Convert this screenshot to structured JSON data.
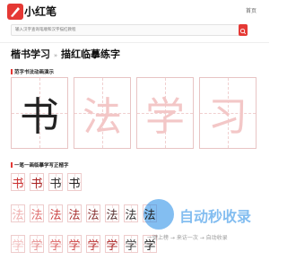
{
  "header": {
    "logo_text": "小红笔",
    "home_link": "首页",
    "search_placeholder": "输入汉字查询笔顺和汉字描红教程"
  },
  "page": {
    "title": "楷书学习",
    "title_sep": "»",
    "title_sub": "描红临摹练字"
  },
  "sections": {
    "demo_title": "范字书法动画演示",
    "practice_title": "一笔一画临摹学写正楷字"
  },
  "big_chars": [
    "书",
    "法",
    "学",
    "习"
  ],
  "rows": [
    [
      "书",
      "书",
      "书",
      "书"
    ],
    [
      "法",
      "法",
      "法",
      "法",
      "法",
      "法",
      "法",
      "法"
    ],
    [
      "学",
      "学",
      "学",
      "学",
      "学",
      "学",
      "学",
      "学"
    ]
  ],
  "colors": {
    "accent": "#e53935",
    "guide": "#f3c7c7",
    "ink": "#222222"
  },
  "watermark": {
    "title": "自动秒收录",
    "subtitle": "一键上榜 → 来访一次 → 自动收录"
  }
}
